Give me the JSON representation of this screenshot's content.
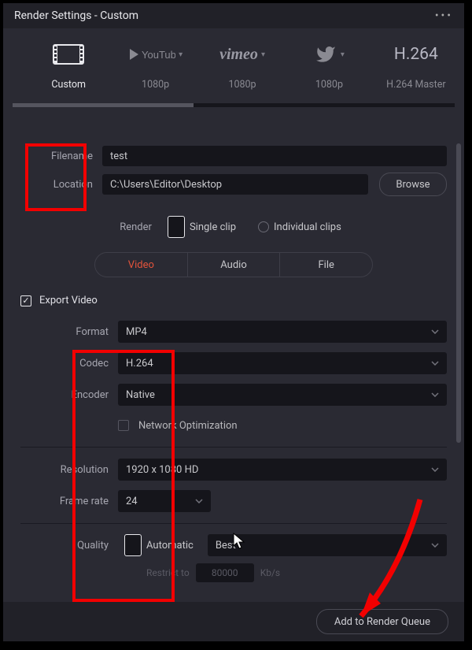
{
  "title": "Render Settings - Custom",
  "presets": [
    {
      "label": "Custom",
      "top": ""
    },
    {
      "label": "1080p",
      "top": "YouTube"
    },
    {
      "label": "1080p",
      "top": "vimeo"
    },
    {
      "label": "1080p",
      "top": ""
    },
    {
      "label": "H.264 Master",
      "top": "H.264"
    }
  ],
  "file": {
    "filename_label": "Filename",
    "filename_value": "test",
    "location_label": "Location",
    "location_value": "C:\\Users\\Editor\\Desktop",
    "browse": "Browse"
  },
  "render": {
    "label": "Render",
    "single": "Single clip",
    "individual": "Individual clips"
  },
  "tabs": {
    "video": "Video",
    "audio": "Audio",
    "file": "File"
  },
  "export_video_label": "Export Video",
  "video": {
    "format_label": "Format",
    "format_value": "MP4",
    "codec_label": "Codec",
    "codec_value": "H.264",
    "encoder_label": "Encoder",
    "encoder_value": "Native",
    "netopt": "Network Optimization",
    "resolution_label": "Resolution",
    "resolution_value": "1920 x 1080 HD",
    "framerate_label": "Frame rate",
    "framerate_value": "24",
    "quality_label": "Quality",
    "quality_auto": "Automatic",
    "quality_best": "Best",
    "restrict_label": "Restrict to",
    "restrict_value": "80000",
    "restrict_unit": "Kb/s"
  },
  "footer": {
    "add": "Add to Render Queue"
  }
}
